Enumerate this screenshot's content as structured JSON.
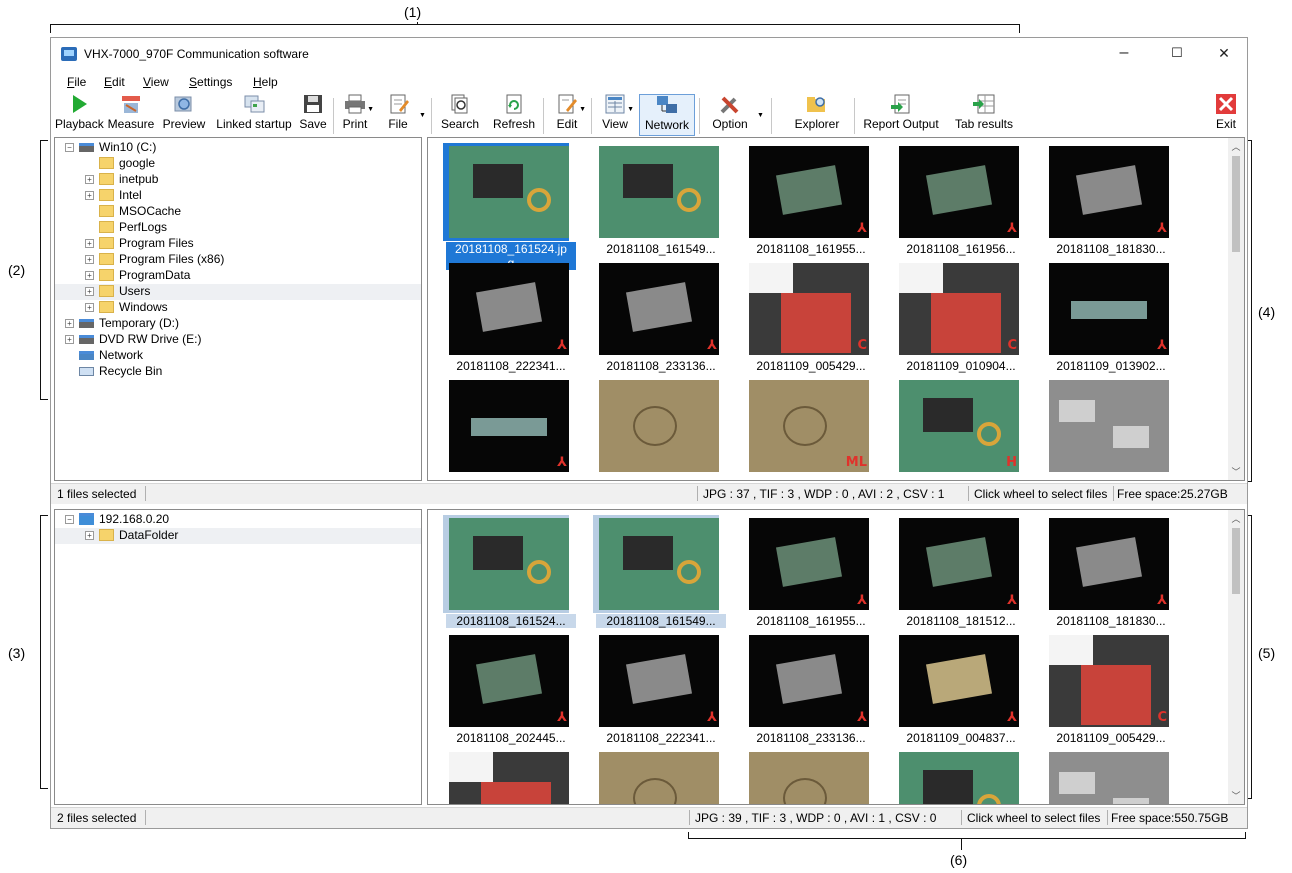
{
  "window": {
    "title": "VHX-7000_970F Communication software",
    "minimize": "–",
    "maximize": "☐",
    "close": "✕"
  },
  "menu": [
    {
      "pre": "",
      "u": "F",
      "post": "ile"
    },
    {
      "pre": "",
      "u": "E",
      "post": "dit"
    },
    {
      "pre": "",
      "u": "V",
      "post": "iew"
    },
    {
      "pre": "",
      "u": "S",
      "post": "ettings"
    },
    {
      "pre": "",
      "u": "H",
      "post": "elp"
    }
  ],
  "toolbar": {
    "playback": "Playback",
    "measure": "Measure",
    "preview": "Preview",
    "linked": "Linked startup",
    "save": "Save",
    "print": "Print",
    "file": "File",
    "search": "Search",
    "refresh": "Refresh",
    "edit": "Edit",
    "view": "View",
    "network": "Network",
    "option": "Option",
    "explorer": "Explorer",
    "report": "Report Output",
    "tab": "Tab results",
    "exit": "Exit"
  },
  "callouts": {
    "c1": "(1)",
    "c2": "(2)",
    "c3": "(3)",
    "c4": "(4)",
    "c5": "(5)",
    "c6": "(6)"
  },
  "local_tree": [
    {
      "label": "Win10 (C:)",
      "kind": "drive",
      "level": 0,
      "expander": "−"
    },
    {
      "label": "google",
      "kind": "folder",
      "level": 1,
      "expander": ""
    },
    {
      "label": "inetpub",
      "kind": "folder",
      "level": 1,
      "expander": "+"
    },
    {
      "label": "Intel",
      "kind": "folder",
      "level": 1,
      "expander": "+"
    },
    {
      "label": "MSOCache",
      "kind": "folder",
      "level": 1,
      "expander": ""
    },
    {
      "label": "PerfLogs",
      "kind": "folder",
      "level": 1,
      "expander": ""
    },
    {
      "label": "Program Files",
      "kind": "folder",
      "level": 1,
      "expander": "+"
    },
    {
      "label": "Program Files (x86)",
      "kind": "folder",
      "level": 1,
      "expander": "+"
    },
    {
      "label": "ProgramData",
      "kind": "folder",
      "level": 1,
      "expander": "+"
    },
    {
      "label": "Users",
      "kind": "folder",
      "level": 1,
      "expander": "+"
    },
    {
      "label": "Windows",
      "kind": "folder",
      "level": 1,
      "expander": "+"
    },
    {
      "label": "Temporary (D:)",
      "kind": "drive",
      "level": 0,
      "expander": "+"
    },
    {
      "label": "DVD RW Drive (E:)",
      "kind": "drive",
      "level": 0,
      "expander": "+"
    },
    {
      "label": "Network",
      "kind": "network",
      "level": 0,
      "expander": ""
    },
    {
      "label": "Recycle Bin",
      "kind": "recycle",
      "level": 0,
      "expander": ""
    }
  ],
  "remote_tree": [
    {
      "label": "192.168.0.20",
      "kind": "computer",
      "level": 0,
      "expander": "−"
    },
    {
      "label": "DataFolder",
      "kind": "share",
      "level": 1,
      "expander": "+"
    }
  ],
  "local_thumbs": [
    {
      "cap": "20181108_161524.jp",
      "cap2": "g",
      "style": "pcb",
      "badge": ""
    },
    {
      "cap": "20181108_161549...",
      "style": "pcb",
      "badge": ""
    },
    {
      "cap": "20181108_161955...",
      "style": "blk",
      "badge": "⅄"
    },
    {
      "cap": "20181108_161956...",
      "style": "blk",
      "badge": "⅄"
    },
    {
      "cap": "20181108_181830...",
      "style": "blk-gray",
      "badge": "⅄"
    },
    {
      "cap": "20181108_222341...",
      "style": "blk-gray",
      "badge": "⅄"
    },
    {
      "cap": "20181108_233136...",
      "style": "blk-gray",
      "badge": "⅄"
    },
    {
      "cap": "20181109_005429...",
      "style": "wht",
      "badge": "C"
    },
    {
      "cap": "20181109_010904...",
      "style": "wht",
      "badge": "C"
    },
    {
      "cap": "20181109_013902...",
      "style": "blk-strip",
      "badge": "⅄"
    },
    {
      "cap": "",
      "style": "blk-strip",
      "badge": "⅄"
    },
    {
      "cap": "",
      "style": "ore",
      "badge": ""
    },
    {
      "cap": "",
      "style": "ore",
      "badge": "ML"
    },
    {
      "cap": "",
      "style": "pcb",
      "badge": "H"
    },
    {
      "cap": "",
      "style": "gry",
      "badge": ""
    }
  ],
  "remote_thumbs": [
    {
      "cap": "20181108_161524...",
      "style": "pcb",
      "badge": ""
    },
    {
      "cap": "20181108_161549...",
      "style": "pcb",
      "badge": ""
    },
    {
      "cap": "20181108_161955...",
      "style": "blk",
      "badge": "⅄"
    },
    {
      "cap": "20181108_181512...",
      "style": "blk",
      "badge": "⅄"
    },
    {
      "cap": "20181108_181830...",
      "style": "blk-gray",
      "badge": "⅄"
    },
    {
      "cap": "20181108_202445...",
      "style": "blk",
      "badge": "⅄"
    },
    {
      "cap": "20181108_222341...",
      "style": "blk-gray",
      "badge": "⅄"
    },
    {
      "cap": "20181108_233136...",
      "style": "blk-gray",
      "badge": "⅄"
    },
    {
      "cap": "20181109_004837...",
      "style": "blk-tan",
      "badge": "⅄"
    },
    {
      "cap": "20181109_005429...",
      "style": "wht",
      "badge": "C"
    },
    {
      "cap": "",
      "style": "wht",
      "badge": ""
    },
    {
      "cap": "",
      "style": "ore",
      "badge": ""
    },
    {
      "cap": "",
      "style": "ore",
      "badge": ""
    },
    {
      "cap": "",
      "style": "pcb",
      "badge": ""
    },
    {
      "cap": "",
      "style": "gry",
      "badge": ""
    }
  ],
  "status_local": {
    "selected": "1 files selected",
    "counts": "JPG : 37 , TIF : 3 , WDP : 0 , AVI : 2 , CSV : 1",
    "hint": "Click wheel to select files",
    "free": "Free space:25.27GB"
  },
  "status_remote": {
    "selected": "2 files selected",
    "counts": "JPG : 39 , TIF : 3 , WDP : 0 , AVI : 1 , CSV : 0",
    "hint": "Click wheel to select files",
    "free": "Free space:550.75GB"
  },
  "colors": {
    "selection": "#1f78d6",
    "accent_red": "#e0322b",
    "exit_red": "#e23b3b",
    "play_green": "#22aa33"
  }
}
